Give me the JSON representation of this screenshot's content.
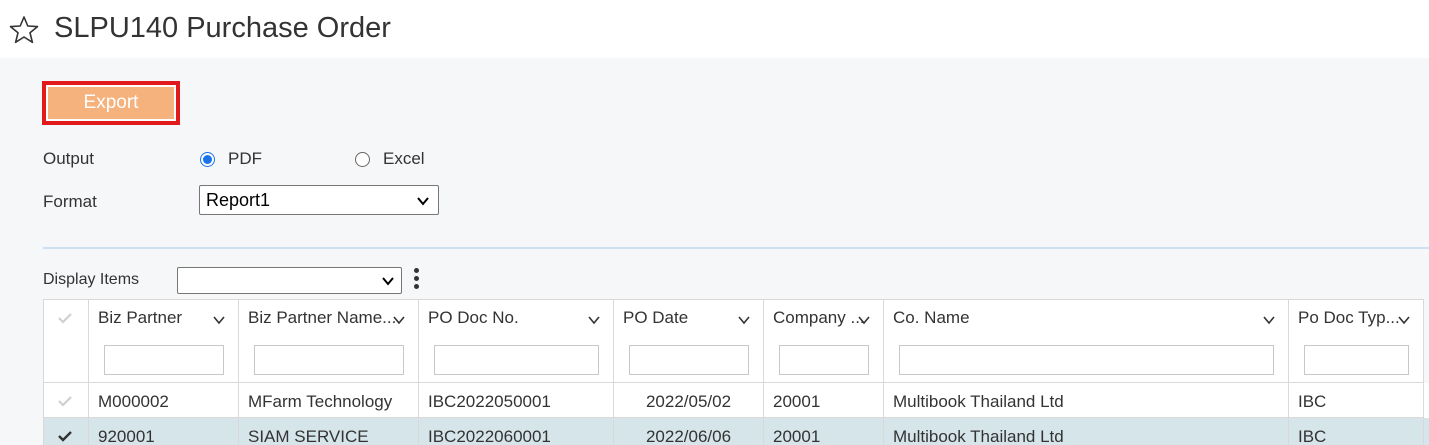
{
  "page": {
    "title": "SLPU140 Purchase Order"
  },
  "toolbar": {
    "export_label": "Export"
  },
  "output": {
    "label": "Output",
    "options": [
      {
        "label": "PDF",
        "checked": true
      },
      {
        "label": "Excel",
        "checked": false
      }
    ]
  },
  "format": {
    "label": "Format",
    "selected": "Report1"
  },
  "display_items": {
    "label": "Display Items",
    "selected": ""
  },
  "table": {
    "columns": [
      "Biz Partner",
      "Biz Partner Name...",
      "PO Doc No.",
      "PO Date",
      "Company ...",
      "Co. Name",
      "Po Doc Typ..."
    ],
    "rows": [
      {
        "checked": false,
        "selected": false,
        "cells": [
          "M000002",
          "MFarm Technology",
          "IBC2022050001",
          "2022/05/02",
          "20001",
          "Multibook Thailand Ltd",
          "IBC"
        ]
      },
      {
        "checked": true,
        "selected": true,
        "cells": [
          "920001",
          "SIAM SERVICE",
          "IBC2022060001",
          "2022/06/06",
          "20001",
          "Multibook Thailand Ltd",
          "IBC"
        ]
      }
    ]
  },
  "colors": {
    "export_bg": "#f5b27d",
    "export_border": "#e11b1b",
    "radio_accent": "#1a73e8",
    "selected_row_bg": "#d6e5ea"
  }
}
